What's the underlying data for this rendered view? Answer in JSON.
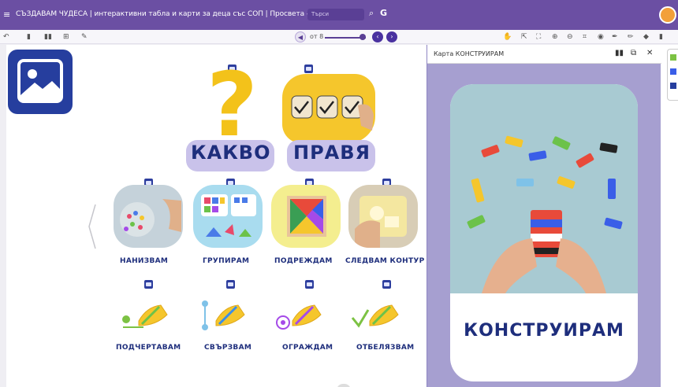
{
  "window": {
    "title": "СЪЗДАВАМ ЧУДЕСА | интерактивни табла и карти за деца със СОП | Просвета – София",
    "search_placeholder": "Търси"
  },
  "toolbar": {
    "page_text": "от 8"
  },
  "board": {
    "heading_left": "КАКВО",
    "heading_right": "ПРАВЯ",
    "activities_row1": [
      "НАНИЗВАМ",
      "ГРУПИРАМ",
      "ПОДРЕЖДАМ",
      "СЛЕДВАМ КОНТУР"
    ],
    "activities_row2": [
      "ПОДЧЕРТАВАМ",
      "СВЪРЗВАМ",
      "ОГРАЖДАМ",
      "ОТБЕЛЯЗВАМ"
    ]
  },
  "panel": {
    "title": "Карта КОНСТРУИРАМ",
    "card_word": "КОНСТРУИРАМ"
  },
  "colors": {
    "brand_purple": "#6b4fa3",
    "heading_blue": "#1e2e7c",
    "accent_yellow": "#f3c21a",
    "panel_lavender": "#a69fd0"
  },
  "icons": [
    "menu-icon",
    "search-icon",
    "google-icon",
    "undo-icon",
    "page-icon",
    "prev-page-icon",
    "next-page-icon",
    "hand-tool-icon",
    "zoom-in-icon",
    "zoom-out-icon",
    "pencil-icon",
    "eraser-icon",
    "close-icon",
    "image-icon"
  ]
}
